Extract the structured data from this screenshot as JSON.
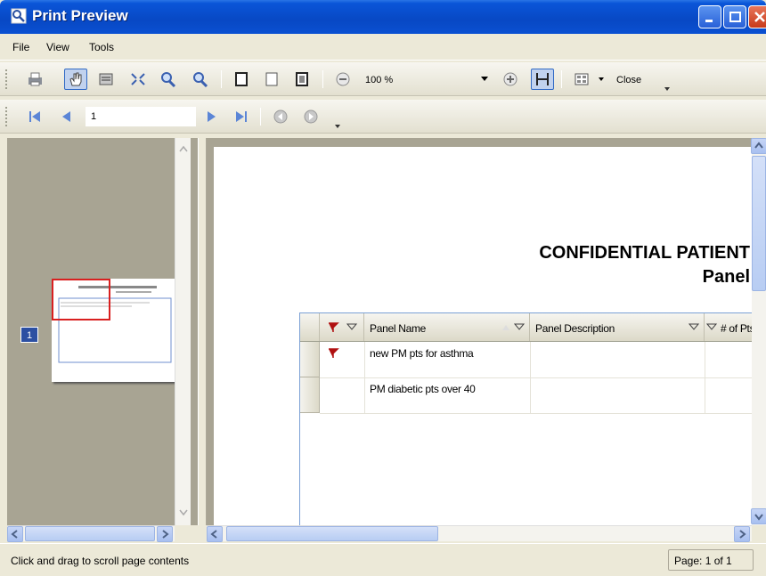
{
  "window": {
    "title": "Print Preview"
  },
  "menu": {
    "file": "File",
    "view": "View",
    "tools": "Tools"
  },
  "toolbar": {
    "icons": [
      "print-icon",
      "hand-icon",
      "magnifier-icon",
      "zoom-fit-icon",
      "zoom-in-icon",
      "zoom-out-icon",
      "single-page-icon",
      "two-page-icon",
      "multi-page-icon",
      "zoom-minus-icon",
      "zoom-plus-icon",
      "fit-width-icon",
      "page-layout-icon"
    ],
    "zoom_value": "100 %",
    "close_label": "Close"
  },
  "nav": {
    "page_value": "1"
  },
  "thumbnail": {
    "page_number": "1"
  },
  "document": {
    "title": "CONFIDENTIAL PATIENT",
    "subtitle": "Panel",
    "columns": [
      "Panel Name",
      "Panel Description",
      "# of Pts"
    ],
    "rows": [
      {
        "panel_name": "new PM pts for asthma",
        "panel_description": "",
        "flagged": true
      },
      {
        "panel_name": "PM diabetic pts over 40",
        "panel_description": "",
        "flagged": false
      }
    ]
  },
  "status": {
    "text": "Click and drag to scroll page contents",
    "page": "Page: 1 of 1"
  },
  "colors": {
    "title_bar": "#0a55d8",
    "flag_red": "#b01010",
    "selection": "#d92020"
  }
}
